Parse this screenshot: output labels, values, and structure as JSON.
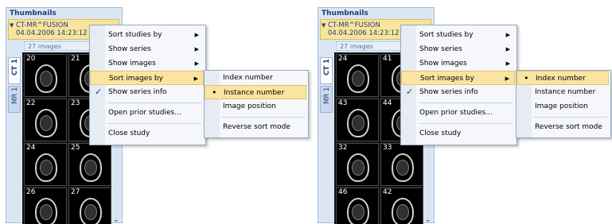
{
  "left": {
    "panel_title": "Thumbnails",
    "study_name": "CT-MR^FUSION",
    "study_date": "04.04.2006 14:23:12",
    "image_count": "27 images",
    "tabs": [
      "CT 1",
      "MR 1"
    ],
    "thumbnails": [
      "20",
      "21",
      "22",
      "23",
      "24",
      "25",
      "26",
      "27"
    ],
    "menu": [
      "Sort studies by",
      "Show series",
      "Show images",
      "Sort images by",
      "Show series info",
      "Open prior studies...",
      "Close study"
    ],
    "submenu": [
      "Index number",
      "Instance number",
      "Image position",
      "Reverse sort mode"
    ]
  },
  "right": {
    "panel_title": "Thumbnails",
    "study_name": "CT-MR^FUSION",
    "study_date": "04.04.2006 14:23:12",
    "image_count": "27 images",
    "tabs": [
      "CT 1",
      "MR 1"
    ],
    "thumbnails": [
      "24",
      "41",
      "43",
      "44",
      "32",
      "33",
      "46",
      "42"
    ],
    "menu": [
      "Sort studies by",
      "Show series",
      "Show images",
      "Sort images by",
      "Show series info",
      "Open prior studies...",
      "Close study"
    ],
    "submenu": [
      "Index number",
      "Instance number",
      "Image position",
      "Reverse sort mode"
    ]
  },
  "icons": {
    "check": "✓",
    "bullet": "•",
    "submenu_arrow": "▶",
    "expander": "▼",
    "scroll_down": "⌄"
  },
  "colors": {
    "highlight": "#fbe4a2",
    "panel": "#dbe6f4",
    "title": "#1e3f78"
  }
}
